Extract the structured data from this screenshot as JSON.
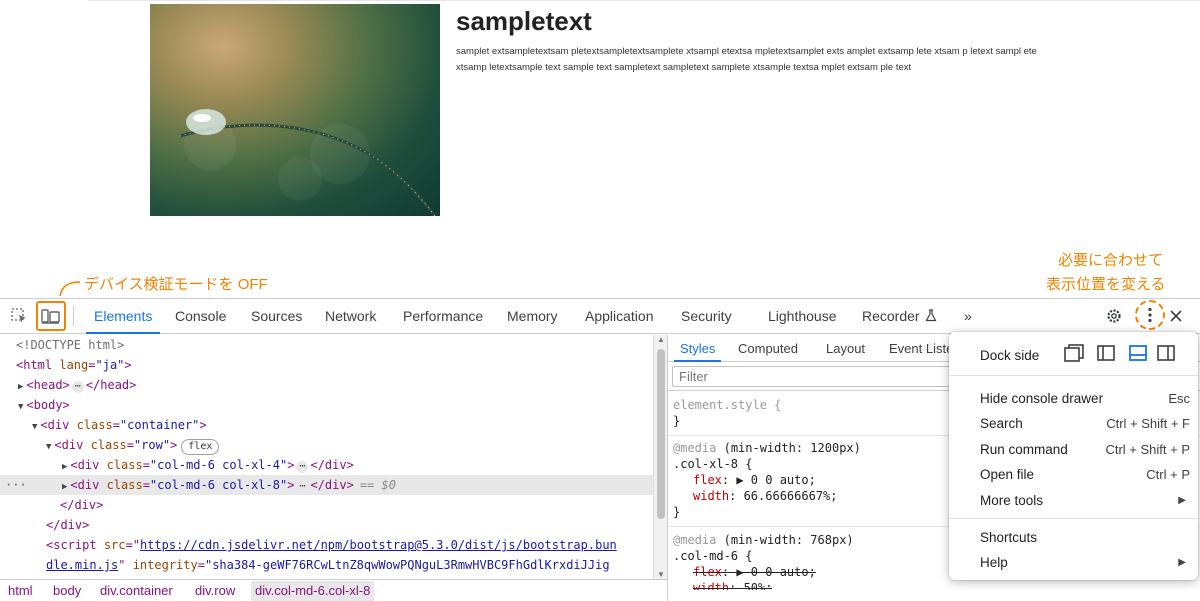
{
  "preview": {
    "heading": "sampletext",
    "body": "samplet extsampletextsam pletextsampletextsamplete xtsampl etextsa mpletextsamplet exts amplet extsamp lete xtsam p letext sampl ete xtsamp letextsample text sample text sampletext sampletext samplete xtsample textsa mplet extsam ple text"
  },
  "annotations": {
    "device_toggle": "デバイス検証モードを OFF",
    "dock_line1": "必要に合わせて",
    "dock_line2": "表示位置を変える"
  },
  "colors": {
    "annotation": "#f08300",
    "accent": "#1a73e8",
    "tag": "#881280",
    "attr": "#994500",
    "attr_value": "#1a1aa6"
  },
  "toolbar": {
    "tabs": [
      "Elements",
      "Console",
      "Sources",
      "Network",
      "Performance",
      "Memory",
      "Application",
      "Security",
      "Lighthouse",
      "Recorder"
    ],
    "active_tab": "Elements",
    "more_label": "»",
    "icons": [
      "inspect-icon",
      "device-toolbar-icon",
      "flask-icon",
      "settings-icon",
      "more-vertical-icon",
      "close-icon"
    ]
  },
  "dom": {
    "doctype": "<!DOCTYPE html>",
    "html_open": "<html",
    "lang_attr": "lang",
    "lang_value": "\"ja\"",
    "gt": ">",
    "head_open": "<head>",
    "head_close": "</head>",
    "body_open": "<body>",
    "div_open": "<div",
    "class_attr": "class",
    "container_value": "\"container\"",
    "row_value": "\"row\"",
    "flex_badge": "flex",
    "col4_value": "\"col-md-6 col-xl-4\"",
    "col8_value": "\"col-md-6 col-xl-8\"",
    "div_close": "</div>",
    "eq_label": "== $0",
    "script_open": "<script",
    "src_attr": "src",
    "src_value_1": "https://cdn.jsdelivr.net/npm/bootstrap@5.3.0/dist/js/bootstrap.bun",
    "src_value_2": "dle.min.js",
    "integrity_attr": "integrity",
    "integrity_value": "\"sha384-geWF76RCwLtnZ8qwWowPQNguL3RmwHVBC9FhGdlKrxdiJJig",
    "ellipsis": "···",
    "row_ellipsis": "⋯"
  },
  "breadcrumb": [
    "html",
    "body",
    "div.container",
    "div.row",
    "div.col-md-6.col-xl-8"
  ],
  "styles": {
    "tabs": [
      "Styles",
      "Computed",
      "Layout",
      "Event Liste"
    ],
    "filter_placeholder": "Filter",
    "element_style": "element.style {",
    "close_brace": "}",
    "media_kw": "@media",
    "media1": "(min-width: 1200px)",
    "sel1": ".col-xl-8 {",
    "flex_prop": "flex",
    "flex_val": "▶ 0 0 auto;",
    "width_prop": "width",
    "width_val1": "66.66666667%;",
    "media2": "(min-width: 768px)",
    "sel2": ".col-md-6 {",
    "width_val2": "50%;"
  },
  "menu": {
    "dock_side": "Dock side",
    "items": [
      {
        "label": "Hide console drawer",
        "shortcut": "Esc"
      },
      {
        "label": "Search",
        "shortcut": "Ctrl + Shift + F"
      },
      {
        "label": "Run command",
        "shortcut": "Ctrl + Shift + P"
      },
      {
        "label": "Open file",
        "shortcut": "Ctrl + P"
      },
      {
        "label": "More tools",
        "shortcut": ""
      }
    ],
    "shortcuts": "Shortcuts",
    "help": "Help"
  }
}
